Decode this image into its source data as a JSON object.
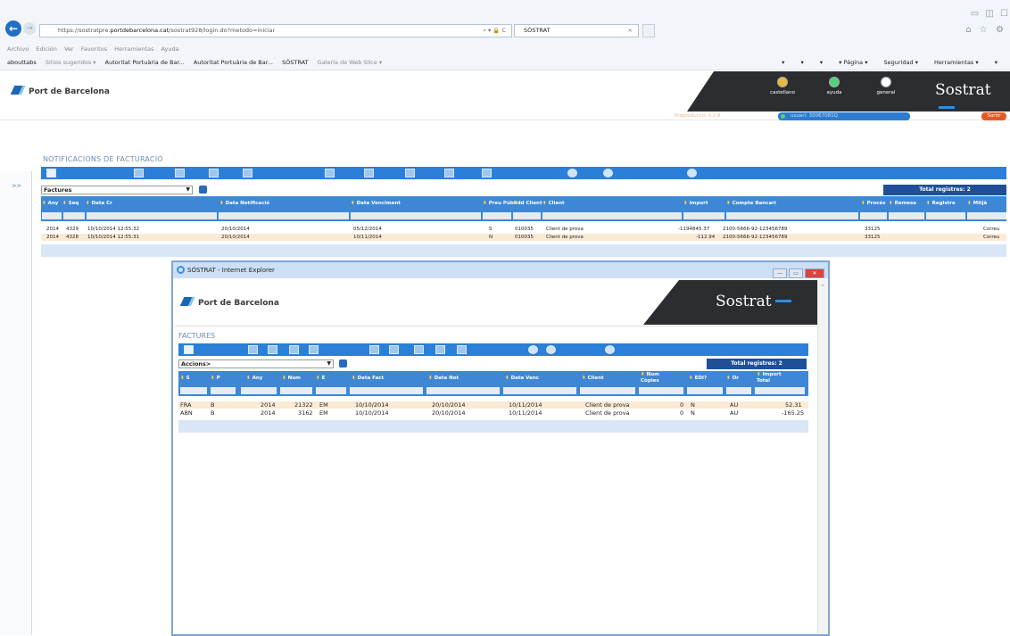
{
  "browser": {
    "url_prefix": "https://sostratpre.",
    "url_domain": "portdebarcelona.cat",
    "url_path": "/sostrat928/login.do?metodo=iniciar",
    "url_controls": "⌕ ▾ 🔒 C",
    "tab_title": "SÓSTRAT",
    "tab_close": "×",
    "window_controls": "▭ ◫ ☐",
    "nav_icons": "⌂ ☆ ⚙",
    "menu": [
      "Archivo",
      "Edición",
      "Ver",
      "Favoritos",
      "Herramientas",
      "Ayuda"
    ],
    "favorites": [
      "abouttabs",
      "Sitios sugeridos ▾",
      "Autoritat Portuària de Bar...",
      "Autoritat Portuària de Bar...",
      "SÓSTRAT",
      "Galería de Web Slice ▾"
    ],
    "tools": [
      "▾",
      "▾",
      "▾",
      "▾ Página ▾",
      "Seguridad ▾",
      "Herramientas ▾",
      "▾"
    ]
  },
  "header": {
    "logo_text": "Port de Barcelona",
    "buttons": [
      {
        "label": "castellano",
        "color": "#e8b93a"
      },
      {
        "label": "ayuda",
        "color": "#4fd37c"
      },
      {
        "label": "general",
        "color": "#ffffff"
      }
    ],
    "brand": "Sostrat",
    "preprod": "Preproducció 9.2.8",
    "user": "usuari: 35067081Q",
    "logout": "Sortir",
    "side_toggle": ">>"
  },
  "main": {
    "title": "NOTIFICACIONS DE FACTURACIÓ",
    "select_value": "Factures",
    "total": "Total registres: 2",
    "columns": [
      "Any",
      "Seq",
      "Data Cr",
      "Data Notificació",
      "Data Venciment",
      "Preu Públic",
      "Id Client",
      "Client",
      "Import",
      "Compte Bancari",
      "Procés",
      "Remesa",
      "Registre",
      "Mitjà"
    ],
    "rows": [
      [
        "2014",
        "4329",
        "10/10/2014 12:55:32",
        "20/10/2014",
        "05/12/2014",
        "S",
        "010035",
        "Client de prova",
        "-1194845.37",
        "2100-5666-92-123456789",
        "33125",
        "",
        "",
        "Correu"
      ],
      [
        "2014",
        "4328",
        "10/10/2014 12:55:31",
        "20/10/2014",
        "10/11/2014",
        "N",
        "010035",
        "Client de prova",
        "-112.94",
        "2100-5666-92-123456789",
        "33125",
        "",
        "",
        "Correu"
      ]
    ]
  },
  "popup": {
    "window_title": "SÓSTRAT - Internet Explorer",
    "controls": [
      "—",
      "▭",
      "✕"
    ],
    "logo_text": "Port de Barcelona",
    "brand": "Sostrat",
    "section_title": "FACTURES",
    "select_value": "Accions>",
    "total": "Total registres: 2",
    "scroll_arrow": "⌃",
    "columns": [
      "S",
      "P",
      "Any",
      "Num",
      "E",
      "Data Fact",
      "Data Not",
      "Data Venc",
      "Client",
      "Num Còpies",
      "EDI?",
      "Or",
      "Import Total"
    ],
    "rows": [
      [
        "FRA",
        "B",
        "2014",
        "21322",
        "EM",
        "10/10/2014",
        "20/10/2014",
        "10/11/2014",
        "Client de prova",
        "0",
        "N",
        "AU",
        "52.31"
      ],
      [
        "ABN",
        "B",
        "2014",
        "3162",
        "EM",
        "10/10/2014",
        "20/10/2014",
        "10/11/2014",
        "Client de prova",
        "0",
        "N",
        "AU",
        "-165.25"
      ]
    ]
  }
}
